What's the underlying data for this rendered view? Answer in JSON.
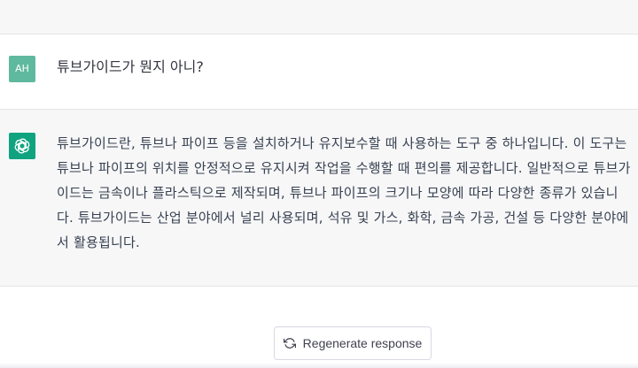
{
  "user_message": {
    "avatar_initials": "AH",
    "avatar_color": "#5fb99e",
    "text": "튜브가이드가 뭔지 아니?"
  },
  "assistant_message": {
    "avatar_icon": "openai-logo-icon",
    "avatar_color": "#10a37f",
    "text": "튜브가이드란, 튜브나 파이프 등을 설치하거나 유지보수할 때 사용하는 도구 중 하나입니다. 이 도구는 튜브나 파이프의 위치를 안정적으로 유지시켜 작업을 수행할 때 편의를 제공합니다. 일반적으로 튜브가이드는 금속이나 플라스틱으로 제작되며, 튜브나 파이프의 크기나 모양에 따라 다양한 종류가 있습니다. 튜브가이드는 산업 분야에서 널리 사용되며, 석유 및 가스, 화학, 금속 가공, 건설 등 다양한 분야에서 활용됩니다."
  },
  "regenerate": {
    "label": "Regenerate response",
    "icon": "refresh-icon"
  }
}
